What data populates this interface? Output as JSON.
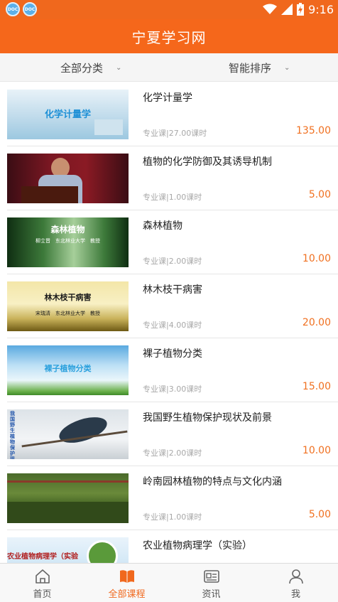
{
  "status_bar": {
    "time": "9:16",
    "app_icons": [
      "app-notification-icon",
      "app-notification-icon"
    ],
    "indicators": [
      "wifi-icon",
      "signal-icon",
      "battery-charging-icon"
    ]
  },
  "header": {
    "title": "宁夏学习网"
  },
  "filters": {
    "category": "全部分类",
    "sort": "智能排序"
  },
  "courses": [
    {
      "title": "化学计量学",
      "type": "专业课",
      "hours": "27.00课时",
      "price": "135.00",
      "thumb_text": "化学计量学"
    },
    {
      "title": "植物的化学防御及其诱导机制",
      "type": "专业课",
      "hours": "1.00课时",
      "price": "5.00",
      "thumb_text": ""
    },
    {
      "title": "森林植物",
      "type": "专业课",
      "hours": "2.00课时",
      "price": "10.00",
      "thumb_text": "森林植物",
      "thumb_sub": "柳立晋　东北林业大学　教授"
    },
    {
      "title": "林木枝干病害",
      "type": "专业课",
      "hours": "4.00课时",
      "price": "20.00",
      "thumb_text": "林木枝干病害",
      "thumb_sub": "宋瑞清　东北林业大学　教授"
    },
    {
      "title": "裸子植物分类",
      "type": "专业课",
      "hours": "3.00课时",
      "price": "15.00",
      "thumb_text": "裸子植物分类"
    },
    {
      "title": "我国野生植物保护现状及前景",
      "type": "专业课",
      "hours": "2.00课时",
      "price": "10.00",
      "thumb_text": "我国野生植物保护现状及前景"
    },
    {
      "title": "岭南园林植物的特点与文化内涵",
      "type": "专业课",
      "hours": "1.00课时",
      "price": "5.00",
      "thumb_text": ""
    },
    {
      "title": "农业植物病理学（实验）",
      "type": "",
      "hours": "",
      "price": "",
      "thumb_text": "农业植物病理学（实验"
    }
  ],
  "meta_separator": "|",
  "bottom_nav": [
    {
      "label": "首页",
      "icon": "home-icon",
      "active": false
    },
    {
      "label": "全部课程",
      "icon": "book-icon",
      "active": true
    },
    {
      "label": "资讯",
      "icon": "news-icon",
      "active": false
    },
    {
      "label": "我",
      "icon": "user-icon",
      "active": false
    }
  ],
  "colors": {
    "brand": "#f5671b",
    "price": "#f07020",
    "meta": "#a8a8a8"
  }
}
